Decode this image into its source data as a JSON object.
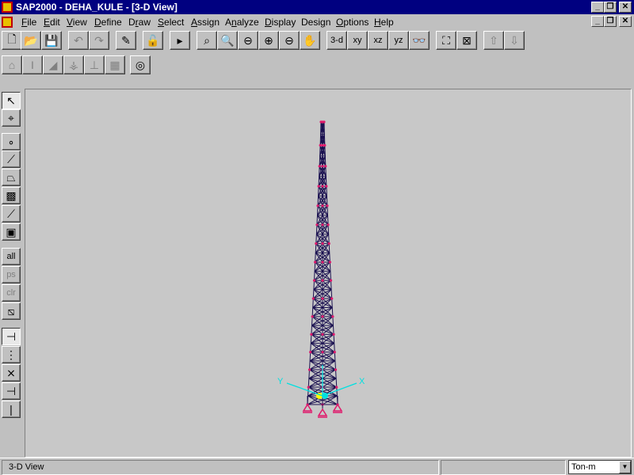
{
  "window": {
    "title": "SAP2000 - DEHA_KULE - [3-D View]",
    "controls": [
      "_",
      "❐",
      "✕"
    ]
  },
  "menu": [
    {
      "label": "File",
      "u": "F"
    },
    {
      "label": "Edit",
      "u": "E"
    },
    {
      "label": "View",
      "u": "V"
    },
    {
      "label": "Define",
      "u": "D"
    },
    {
      "label": "Draw",
      "u": "r"
    },
    {
      "label": "Select",
      "u": "S"
    },
    {
      "label": "Assign",
      "u": "A"
    },
    {
      "label": "Analyze",
      "u": "n"
    },
    {
      "label": "Display",
      "u": "D"
    },
    {
      "label": "Design",
      "u": "g"
    },
    {
      "label": "Options",
      "u": "O"
    },
    {
      "label": "Help",
      "u": "H"
    }
  ],
  "toolbar_main": [
    {
      "name": "new-file",
      "icon": "🗋"
    },
    {
      "name": "open-file",
      "icon": "📂"
    },
    {
      "name": "save",
      "icon": "💾"
    },
    {
      "name": "undo",
      "icon": "↶",
      "disabled": true
    },
    {
      "name": "redo",
      "icon": "↷",
      "disabled": true
    },
    {
      "name": "lock-edit",
      "icon": "✎"
    },
    {
      "name": "lock-model",
      "icon": "🔓"
    },
    {
      "name": "run-analysis",
      "icon": "▸"
    },
    {
      "name": "zoom-window",
      "icon": "⌕"
    },
    {
      "name": "restore-full-view",
      "icon": "🔍"
    },
    {
      "name": "restore-previous-zoom",
      "icon": "⊖"
    },
    {
      "name": "zoom-in",
      "icon": "⊕"
    },
    {
      "name": "zoom-out",
      "icon": "⊖"
    },
    {
      "name": "pan",
      "icon": "✋"
    },
    {
      "name": "view-3d",
      "label": "3-d"
    },
    {
      "name": "view-xy",
      "label": "xy"
    },
    {
      "name": "view-xz",
      "label": "xz"
    },
    {
      "name": "view-yz",
      "label": "yz"
    },
    {
      "name": "perspective",
      "icon": "👓"
    },
    {
      "name": "shrink-elements",
      "icon": "⛶"
    },
    {
      "name": "set-elements",
      "icon": "⊠"
    },
    {
      "name": "move-up",
      "icon": "⇧",
      "disabled": true
    },
    {
      "name": "move-down",
      "icon": "⇩",
      "disabled": true
    }
  ],
  "toolbar_display": [
    {
      "name": "show-undeformed",
      "icon": "⌂",
      "disabled": true
    },
    {
      "name": "show-loads",
      "icon": "I",
      "disabled": true
    },
    {
      "name": "show-deformed",
      "icon": "◢",
      "disabled": true
    },
    {
      "name": "show-mode-shape",
      "icon": "⚶",
      "disabled": true
    },
    {
      "name": "show-element-forces",
      "icon": "⊥",
      "disabled": true
    },
    {
      "name": "show-stresses",
      "icon": "▦",
      "disabled": true
    },
    {
      "name": "show-design",
      "icon": "◎"
    }
  ],
  "toolbar_side": [
    {
      "name": "pointer",
      "icon": "↖",
      "on": true
    },
    {
      "name": "reshape",
      "icon": "⌖"
    },
    {
      "name": "draw-joint",
      "icon": "∘"
    },
    {
      "name": "draw-frame",
      "icon": "⟋"
    },
    {
      "name": "draw-shell",
      "icon": "⏢"
    },
    {
      "name": "draw-rect-shell",
      "icon": "▩"
    },
    {
      "name": "draw-frame-click",
      "icon": "⟋"
    },
    {
      "name": "draw-shell-click",
      "icon": "▣"
    },
    {
      "name": "select-all",
      "label": "all"
    },
    {
      "name": "get-previous-selection",
      "label": "ps",
      "disabled": true
    },
    {
      "name": "clear-selection",
      "label": "clr",
      "disabled": true
    },
    {
      "name": "intersecting-line-select",
      "icon": "⧅"
    },
    {
      "name": "snap-joints",
      "icon": "⊣",
      "on": true
    },
    {
      "name": "snap-midpoints",
      "icon": "⋮"
    },
    {
      "name": "snap-intersections",
      "icon": "⨯"
    },
    {
      "name": "snap-perpendicular",
      "icon": "⊣"
    },
    {
      "name": "snap-lines",
      "icon": "|"
    }
  ],
  "viewport": {
    "axes": {
      "x": "X",
      "y": "Y"
    },
    "colors": {
      "frame": "#1a1050",
      "joint": "#e0186a",
      "axis": "#00e0e0",
      "origin": "#ffff00"
    }
  },
  "status": {
    "text": "3-D View",
    "units": "Ton-m"
  }
}
